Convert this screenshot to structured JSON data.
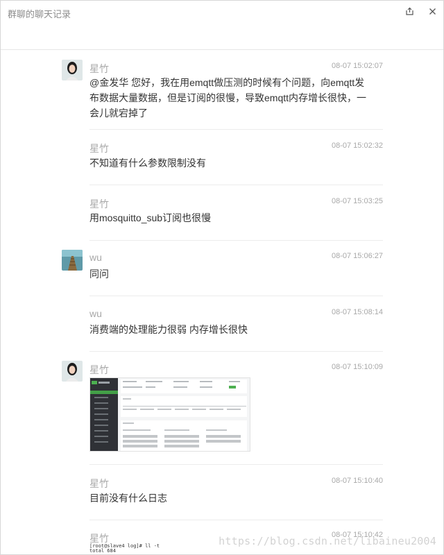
{
  "window": {
    "title": "群聊的聊天记录",
    "share_icon": "share-export-icon",
    "close_icon": "close-icon"
  },
  "messages": [
    {
      "sender": "星竹",
      "time": "08-07 15:02:07",
      "text": "@金发华 您好，我在用emqtt做压测的时候有个问题，向emqtt发布数据大量数据，但是订阅的很慢，导致emqtt内存增长很快，一会儿就宕掉了"
    },
    {
      "sender": "星竹",
      "time": "08-07 15:02:32",
      "text": "不知道有什么参数限制没有"
    },
    {
      "sender": "星竹",
      "time": "08-07 15:03:25",
      "text": "用mosquitto_sub订阅也很慢"
    },
    {
      "sender": "wu",
      "time": "08-07 15:06:27",
      "text": "同问"
    },
    {
      "sender": "wu",
      "time": "08-07 15:08:14",
      "text": "消费端的处理能力很弱 内存增长很快"
    },
    {
      "sender": "星竹",
      "time": "08-07 15:10:09",
      "text": ""
    },
    {
      "sender": "星竹",
      "time": "08-07 15:10:40",
      "text": "目前没有什么日志"
    },
    {
      "sender": "星竹",
      "time": "08-07 15:10:42",
      "text": ""
    }
  ],
  "terminal": {
    "line1": "[root@slave4 log]# ll -t",
    "line2": "total 684"
  },
  "watermark": "https://blog.csdn.net/libaineu2004"
}
